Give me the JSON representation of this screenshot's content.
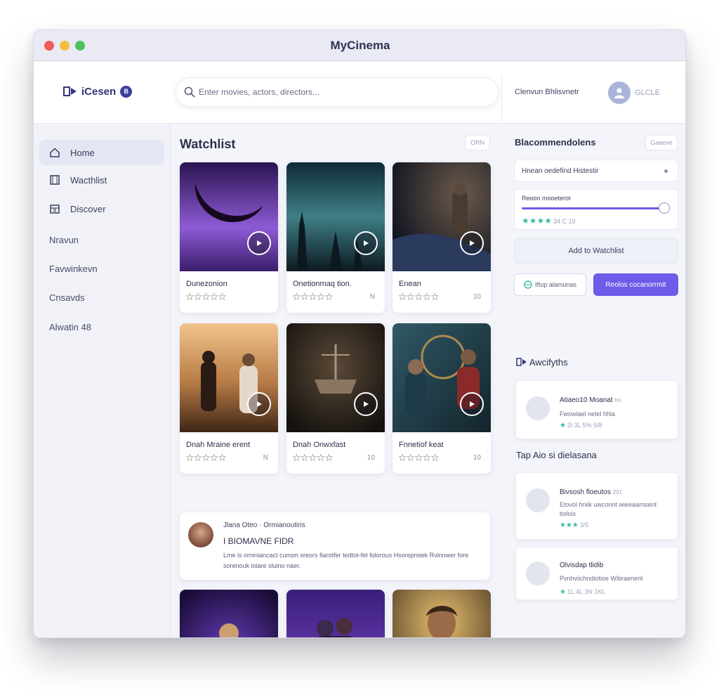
{
  "window": {
    "title": "MyCinema"
  },
  "header": {
    "brand": "iCesen",
    "brand_badge": "B",
    "search_placeholder": "Enter movies, actors, directors...",
    "user_label": "Clenvun Bhlisvnetr",
    "user_tag": "GLCLE"
  },
  "sidebar": {
    "items": [
      {
        "label": "Home"
      },
      {
        "label": "Wacthlist"
      },
      {
        "label": "Discover"
      }
    ],
    "plain": [
      {
        "label": "Nravun"
      },
      {
        "label": "Favwinkevn"
      },
      {
        "label": "Cnsavds"
      },
      {
        "label": "Alwatin 48"
      }
    ]
  },
  "main": {
    "title": "Watchlist",
    "chip": "ORN",
    "cards": [
      {
        "title": "Dunezonion",
        "stars": "☆☆☆☆☆",
        "rating": "",
        "tags": ""
      },
      {
        "title": "Onetionmaq tion.",
        "stars": "☆☆☆☆☆",
        "rating": "N",
        "tags": ""
      },
      {
        "title": "Enean",
        "stars": "☆☆☆☆☆",
        "rating": "10",
        "tags": ""
      },
      {
        "title": "Dnah Mraine erent",
        "stars": "☆☆☆☆☆",
        "rating": "N",
        "tags": ""
      },
      {
        "title": "Dnah Onwxfast",
        "stars": "☆☆☆☆☆",
        "rating": "10",
        "tags": ""
      },
      {
        "title": "Fnnetiof keat",
        "stars": "☆☆☆☆☆",
        "rating": "10",
        "tags": ""
      }
    ],
    "review": {
      "name": "Jlana Oteo · Ormianoutiris",
      "subtitle": "I BIOMAVNE FIDR",
      "text": "Lme is orniniancact cumon sreors fiarotfer tedtot-fet folorous Hsoreproiek Rvinnwer fore sorenouk ioiare sluino naer."
    }
  },
  "right": {
    "title": "Blacommendolens",
    "chip": "Gaeeve",
    "filter1": "Hnean oedefind Histestir",
    "filter2": "Reoon mooeterot",
    "filter2_stars": "★★★★",
    "filter2_count": "34 C 19",
    "add_button": "Add to Watchlist",
    "outline_button": "Iftup alamunas",
    "primary_button": "Reolos cocanorrmit",
    "section1_title": "Awcifyths",
    "section2_title": "Tap Aio si dielasana",
    "cards": [
      {
        "title": "Atiaeo10 Moanat",
        "title_extra": "hn",
        "subtitle": "Fwowiael netel hhla",
        "stars": "★",
        "meta": "2l 3L 5% 5/8"
      },
      {
        "title": "Bivsosh floeutos",
        "title_extra": "201",
        "subtitle": "Etovol hniik uwconnt wieeaarnsent tiolois",
        "stars": "★★★",
        "meta": "3/5"
      },
      {
        "title": "Olvisdap tlidib",
        "title_extra": "",
        "subtitle": "Pvnhviichndiotioe Wibraenerit",
        "stars": "★",
        "meta": "1L 4L 3N 1KL"
      }
    ]
  }
}
